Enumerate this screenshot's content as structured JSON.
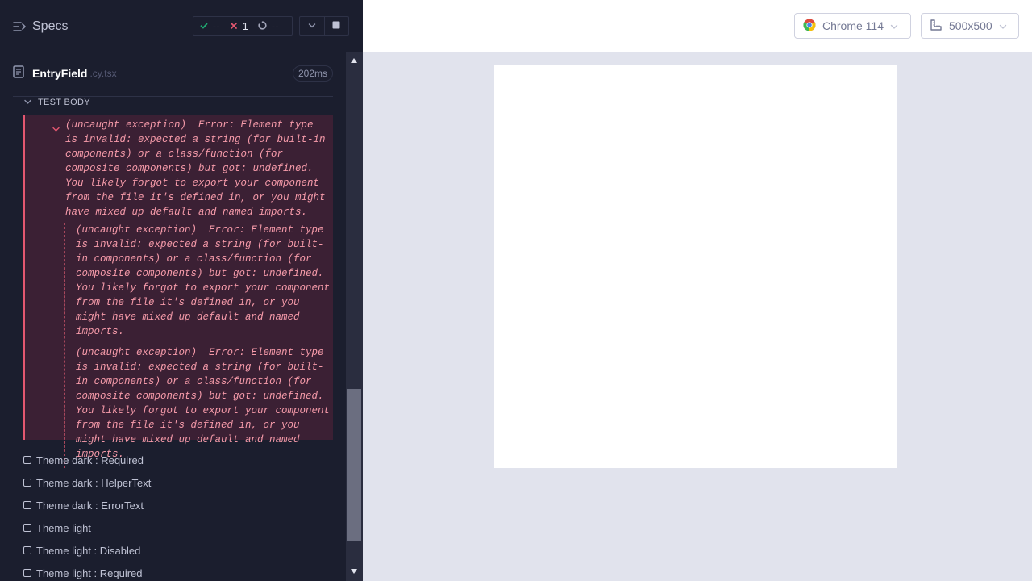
{
  "header": {
    "specs_label": "Specs",
    "stats": {
      "passed": "--",
      "failed": "1",
      "pending": "--"
    }
  },
  "file": {
    "name": "EntryField",
    "ext": ".cy.tsx",
    "duration": "202ms"
  },
  "test_body_label": "TEST BODY",
  "error": {
    "main": "(uncaught exception)  Error: Element type is invalid: expected a string (for built-in components) or a class/function (for composite components) but got: undefined. You likely forgot to export your component from the file it's defined in, or you might have mixed up default and named imports.",
    "nested": [
      "(uncaught exception)  Error: Element type is invalid: expected a string (for built-in components) or a class/function (for composite components) but got: undefined. You likely forgot to export your component from the file it's defined in, or you might have mixed up default and named imports.",
      "(uncaught exception)  Error: Element type is invalid: expected a string (for built-in components) or a class/function (for composite components) but got: undefined. You likely forgot to export your component from the file it's defined in, or you might have mixed up default and named imports."
    ]
  },
  "tests": [
    "Theme dark : Required",
    "Theme dark : HelperText",
    "Theme dark : ErrorText",
    "Theme light",
    "Theme light : Disabled",
    "Theme light : Required"
  ],
  "browser": {
    "label": "Chrome 114"
  },
  "viewport": {
    "label": "500x500"
  },
  "colors": {
    "panel_bg": "#1b1e2e",
    "fail": "#e45770",
    "pass": "#1fa971",
    "aut_bg": "#e1e3ed"
  }
}
